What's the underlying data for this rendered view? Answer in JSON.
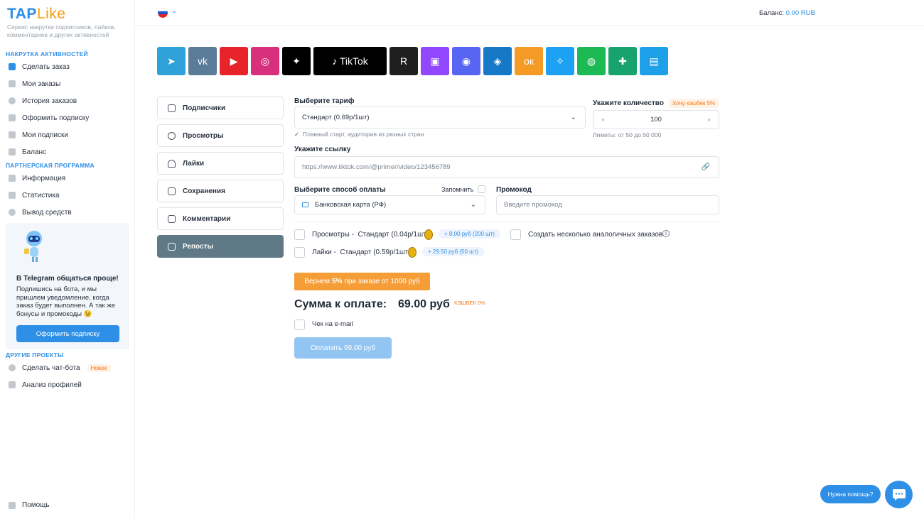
{
  "sidebar": {
    "logo_tap": "TAP",
    "logo_like": "Like",
    "tagline": "Сервис накрутки подписчиков, лайков, комментариев и других активностей",
    "section1": "НАКРУТКА АКТИВНОСТЕЙ",
    "items1": [
      "Сделать заказ",
      "Мои заказы",
      "История заказов",
      "Оформить подписку",
      "Мои подписки",
      "Баланс"
    ],
    "section2": "ПАРТНЕРСКАЯ ПРОГРАММА",
    "items2": [
      "Информация",
      "Статистика",
      "Вывод средств"
    ],
    "promo_title": "В Telegram общаться проще!",
    "promo_text": "Подпишись на бота, и мы пришлем уведомление, когда заказ будет выполнен. А так же бонусы и промокоды 😉",
    "promo_button": "Оформить подписку",
    "section3": "ДРУГИЕ ПРОЕКТЫ",
    "items3": [
      "Сделать чат-бота",
      "Анализ профилей"
    ],
    "new_badge": "Новое",
    "help": "Помощь"
  },
  "topbar": {
    "balance_label": "Баланс:",
    "balance_value": "0.00 RUB"
  },
  "platforms": [
    {
      "name": "telegram",
      "glyph": "➤",
      "color": "#2fa3d9"
    },
    {
      "name": "vk",
      "glyph": "vk",
      "color": "#5b7c99"
    },
    {
      "name": "youtube",
      "glyph": "▶",
      "color": "#e8242a"
    },
    {
      "name": "instagram",
      "glyph": "◎",
      "color": "#d8307c"
    },
    {
      "name": "threads",
      "glyph": "✦",
      "color": "#000000"
    },
    {
      "name": "tiktok",
      "glyph": "♪ TikTok",
      "color": "#000000"
    },
    {
      "name": "rutube",
      "glyph": "R",
      "color": "#1f1f1f"
    },
    {
      "name": "twitch",
      "glyph": "▣",
      "color": "#9147ff"
    },
    {
      "name": "discord",
      "glyph": "◉",
      "color": "#5865f2"
    },
    {
      "name": "likee",
      "glyph": "◈",
      "color": "#1679c8"
    },
    {
      "name": "odnoklassniki",
      "glyph": "ок",
      "color": "#f59a24"
    },
    {
      "name": "twitter",
      "glyph": "✧",
      "color": "#1da1f2"
    },
    {
      "name": "spotify",
      "glyph": "◍",
      "color": "#1db954"
    },
    {
      "name": "zen",
      "glyph": "✚",
      "color": "#18a36c"
    },
    {
      "name": "chat",
      "glyph": "▤",
      "color": "#1ea0e8"
    }
  ],
  "categories": [
    "Подписчики",
    "Просмотры",
    "Лайки",
    "Сохранения",
    "Комментарии",
    "Репосты"
  ],
  "form": {
    "tariff_label": "Выберите тариф",
    "tariff_value": "Стандарт (0.69р/1шт)",
    "tariff_hint": "Плавный старт, аудитория из разных стран",
    "qty_label": "Укажите количество",
    "cashback_tag": "Хочу кэшбек 5%",
    "qty_value": "100",
    "qty_limits": "Лимиты: от 50 до 50 000",
    "link_label": "Укажите ссылку",
    "link_placeholder": "https://www.tiktok.com/@primer/video/123456789",
    "payment_label": "Выберите способ оплаты",
    "remember_label": "Запомнить",
    "payment_value": "Банковская карта (РФ)",
    "promo_label": "Промокод",
    "promo_placeholder": "Введите промокод",
    "addon1_label": "Просмотры -",
    "addon1_tariff": "Стандарт (0.04р/1шт)",
    "addon1_bonus": "+ 8.00 руб (200 шт)",
    "addon2_label": "Лайки -",
    "addon2_tariff": "Стандарт (0.59р/1шт)",
    "addon2_bonus": "+ 29.50 руб (50 шт)",
    "multi_orders": "Создать несколько аналогичных заказов",
    "banner_pre": "Вернем ",
    "banner_bold": "5%",
    "banner_post": " при заказе от 1000 руб",
    "total_label": "Сумма к оплате:",
    "total_value": "69.00 руб",
    "cashback_total": "КЭШБЕК 0%",
    "receipt_label": "Чек на e-mail",
    "pay_button": "Оплатить 69.00 руб"
  },
  "help_widget": {
    "bubble": "Нужна помощь?"
  }
}
